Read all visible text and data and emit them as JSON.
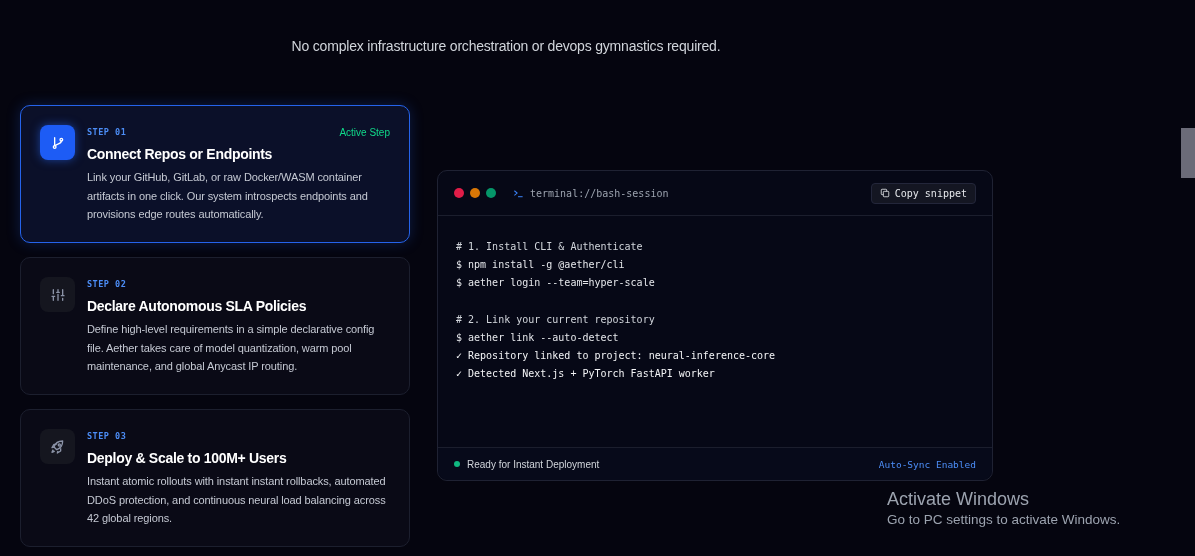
{
  "tagline": "No complex infrastructure orchestration or devops gymnastics required.",
  "steps": [
    {
      "step": "STEP 01",
      "kind": "branch",
      "selected": true,
      "status": "Active Step",
      "title": "Connect Repos or Endpoints",
      "description": "Link your GitHub, GitLab, or raw Docker/WASM container artifacts in one click. Our system introspects endpoints and provisions edge routes automatically."
    },
    {
      "step": "STEP 02",
      "kind": "sliders",
      "selected": false,
      "title": "Declare Autonomous SLA Policies",
      "description": "Define high-level requirements in a simple declarative config file. Aether takes care of model quantization, warm pool maintenance, and global Anycast IP routing."
    },
    {
      "step": "STEP 03",
      "kind": "rocket",
      "selected": false,
      "title": "Deploy & Scale to 100M+ Users",
      "description": "Instant atomic rollouts with instant instant rollbacks, automated DDoS protection, and continuous neural load balancing across 42 global regions."
    }
  ],
  "terminal": {
    "title": "terminal://bash-session",
    "copy_button": "Copy snippet",
    "blocks": [
      [
        {
          "kind": "comment",
          "text": "# 1. Install CLI & Authenticate"
        },
        {
          "kind": "command",
          "text": "$ npm install -g @aether/cli"
        },
        {
          "kind": "command",
          "text": "$ aether login --team=hyper-scale"
        }
      ],
      [
        {
          "kind": "comment",
          "text": "# 2. Link your current repository"
        },
        {
          "kind": "command",
          "text": "$ aether link --auto-detect"
        },
        {
          "kind": "success",
          "text": "✓ Repository linked to project: neural-inference-core"
        },
        {
          "kind": "success",
          "text": "✓ Detected Next.js + PyTorch FastAPI worker"
        }
      ]
    ],
    "status": "Ready for Instant Deployment",
    "sync": "Auto-Sync Enabled"
  },
  "system_notice": {
    "title": "Activate Windows",
    "subtitle": "Go to PC settings to activate Windows."
  }
}
